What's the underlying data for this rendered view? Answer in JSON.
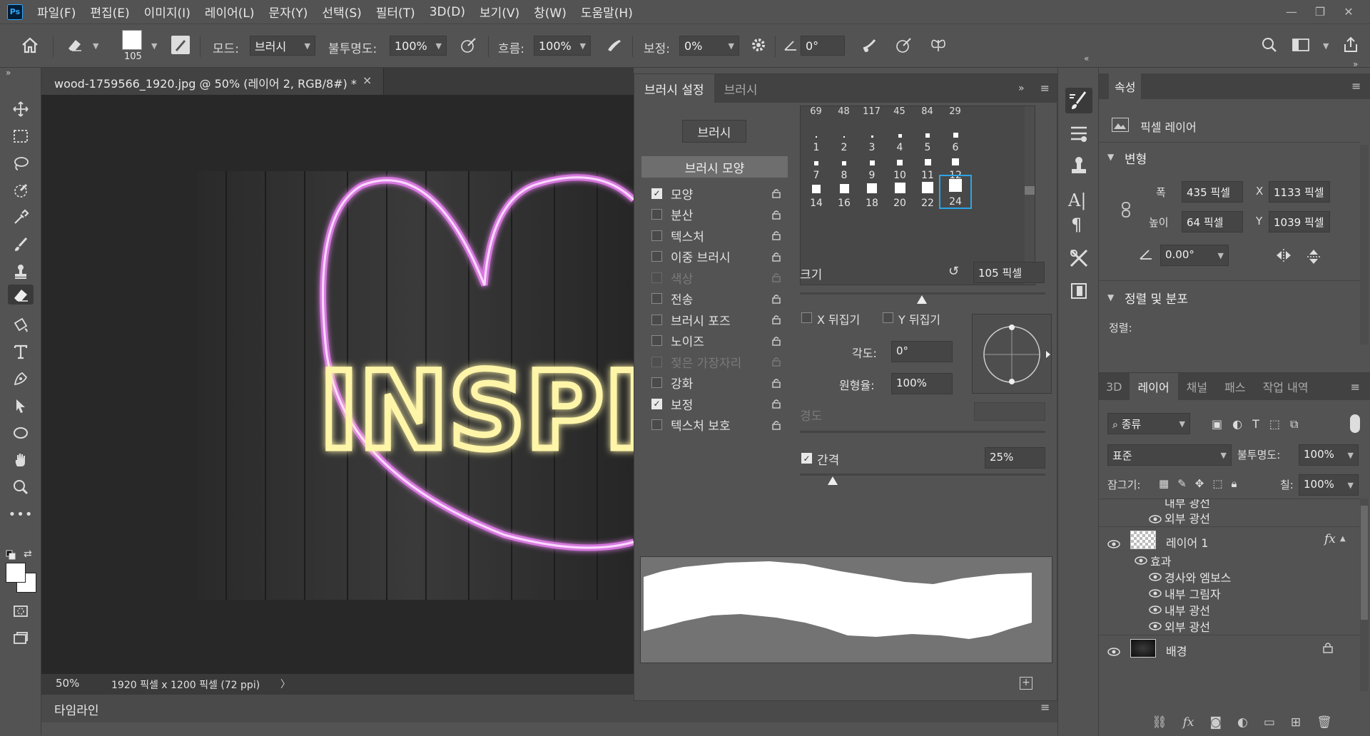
{
  "menu": {
    "logo": "Ps",
    "items": [
      "파일(F)",
      "편집(E)",
      "이미지(I)",
      "레이어(L)",
      "문자(Y)",
      "선택(S)",
      "필터(T)",
      "3D(D)",
      "보기(V)",
      "창(W)",
      "도움말(H)"
    ]
  },
  "options": {
    "brush_size": "105",
    "mode_label": "모드:",
    "mode_value": "브러시",
    "opacity_label": "불투명도:",
    "opacity_value": "100%",
    "flow_label": "흐름:",
    "flow_value": "100%",
    "smoothing_label": "보정:",
    "smoothing_value": "0%",
    "angle_value": "0°"
  },
  "document": {
    "tab_title": "wood-1759566_1920.jpg @ 50% (레이어 2, RGB/8#) *",
    "canvas_text": "INSPI",
    "zoom": "50%",
    "doc_info": "1920 픽셀 x 1200 픽셀 (72 ppi)"
  },
  "timeline": {
    "label": "타임라인"
  },
  "brush_panel": {
    "tabs": [
      "브러시 설정",
      "브러시"
    ],
    "brushes_button": "브러시",
    "brush_tip_shape": "브러시 모양",
    "options": [
      {
        "label": "모양",
        "checked": true,
        "enabled": true
      },
      {
        "label": "분산",
        "checked": false,
        "enabled": true
      },
      {
        "label": "텍스처",
        "checked": false,
        "enabled": true
      },
      {
        "label": "이중 브러시",
        "checked": false,
        "enabled": true
      },
      {
        "label": "색상",
        "checked": false,
        "enabled": false
      },
      {
        "label": "전송",
        "checked": false,
        "enabled": true
      },
      {
        "label": "브러시 포즈",
        "checked": false,
        "enabled": true
      },
      {
        "label": "노이즈",
        "checked": false,
        "enabled": true
      },
      {
        "label": "젖은 가장자리",
        "checked": false,
        "enabled": false
      },
      {
        "label": "강화",
        "checked": false,
        "enabled": true
      },
      {
        "label": "보정",
        "checked": true,
        "enabled": true
      },
      {
        "label": "텍스처 보호",
        "checked": false,
        "enabled": true
      }
    ],
    "tip_header": [
      "69",
      "48",
      "117",
      "45",
      "84",
      "29"
    ],
    "tip_rows": [
      [
        "1",
        "2",
        "3",
        "4",
        "5",
        "6"
      ],
      [
        "7",
        "8",
        "9",
        "10",
        "11",
        "12"
      ],
      [
        "14",
        "16",
        "18",
        "20",
        "22",
        "24"
      ]
    ],
    "size_label": "크기",
    "size_value": "105 픽셀",
    "flip_x": "X 뒤집기",
    "flip_y": "Y 뒤집기",
    "angle_label": "각도:",
    "angle_value": "0°",
    "roundness_label": "원형율:",
    "roundness_value": "100%",
    "hardness_label": "경도",
    "spacing_label": "간격",
    "spacing_value": "25%",
    "spacing_checked": true
  },
  "properties": {
    "title": "속성",
    "layer_type": "픽셀 레이어",
    "transform_title": "변형",
    "width_label": "폭",
    "width_value": "435 픽셀",
    "x_label": "X",
    "x_value": "1133 픽셀",
    "height_label": "높이",
    "height_value": "64 픽셀",
    "y_label": "Y",
    "y_value": "1039 픽셀",
    "rotation_value": "0.00°",
    "align_title": "정렬 및 분포",
    "align_label": "정렬:"
  },
  "layers": {
    "tabs": [
      "3D",
      "레이어",
      "채널",
      "패스",
      "작업 내역"
    ],
    "filter_kind": "종류",
    "blend_mode": "표준",
    "opacity_label": "불투명도:",
    "opacity_value": "100%",
    "lock_label": "잠그기:",
    "fill_label": "칠:",
    "fill_value": "100%",
    "partial_effect_top": "내부 광선",
    "partial_effect_outer": "외부 광선",
    "layer1_name": "레이어 1",
    "fx_label": "fx",
    "effects_label": "효과",
    "layer1_effects": [
      "경사와 엠보스",
      "내부 그림자",
      "내부 광선",
      "외부 광선"
    ],
    "background_name": "배경"
  }
}
